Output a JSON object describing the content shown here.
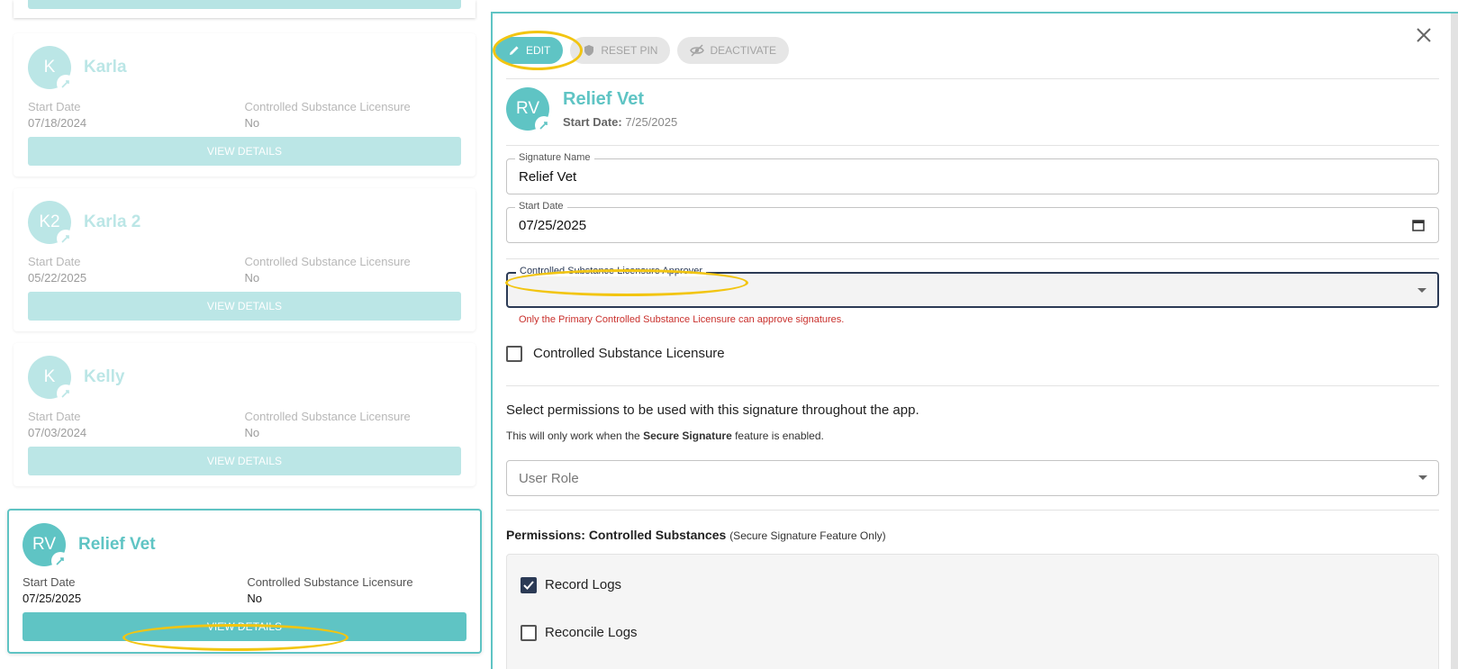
{
  "cards": [
    {
      "initials": "K",
      "name": "Karla",
      "start_date_label": "Start Date",
      "start_date": "07/18/2024",
      "csl_label": "Controlled Substance Licensure",
      "csl_value": "No",
      "button": "VIEW DETAILS"
    },
    {
      "initials": "K2",
      "name": "Karla 2",
      "start_date_label": "Start Date",
      "start_date": "05/22/2025",
      "csl_label": "Controlled Substance Licensure",
      "csl_value": "No",
      "button": "VIEW DETAILS"
    },
    {
      "initials": "K",
      "name": "Kelly",
      "start_date_label": "Start Date",
      "start_date": "07/03/2024",
      "csl_label": "Controlled Substance Licensure",
      "csl_value": "No",
      "button": "VIEW DETAILS"
    },
    {
      "initials": "RV",
      "name": "Relief Vet",
      "start_date_label": "Start Date",
      "start_date": "07/25/2025",
      "csl_label": "Controlled Substance Licensure",
      "csl_value": "No",
      "button": "VIEW DETAILS"
    }
  ],
  "panel": {
    "toolbar": {
      "edit": "EDIT",
      "reset_pin": "RESET PIN",
      "deactivate": "DEACTIVATE"
    },
    "header": {
      "initials": "RV",
      "name": "Relief Vet",
      "start_date_label": "Start Date:",
      "start_date": "7/25/2025"
    },
    "signature_name": {
      "label": "Signature Name",
      "value": "Relief Vet"
    },
    "start_date": {
      "label": "Start Date",
      "value": "07/25/2025"
    },
    "approver": {
      "label": "Controlled Substance Licensure Approver",
      "value": ""
    },
    "approver_error": "Only the Primary Controlled Substance Licensure can approve signatures.",
    "csl_checkbox_label": "Controlled Substance Licensure",
    "permissions_text": "Select permissions to be used with this signature throughout the app.",
    "permissions_sub_pre": "This will only work when the ",
    "permissions_sub_bold": "Secure Signature",
    "permissions_sub_post": " feature is enabled.",
    "user_role_placeholder": "User Role",
    "cs_title_bold": "Permissions: Controlled Substances",
    "cs_title_small": "(Secure Signature Feature Only)",
    "cs_items": [
      {
        "label": "Record Logs",
        "checked": true
      },
      {
        "label": "Reconcile Logs",
        "checked": false
      }
    ]
  },
  "colors": {
    "accent": "#5fc4c4",
    "navy": "#2b3a55",
    "error": "#c9302c",
    "highlight": "#f2c511"
  }
}
